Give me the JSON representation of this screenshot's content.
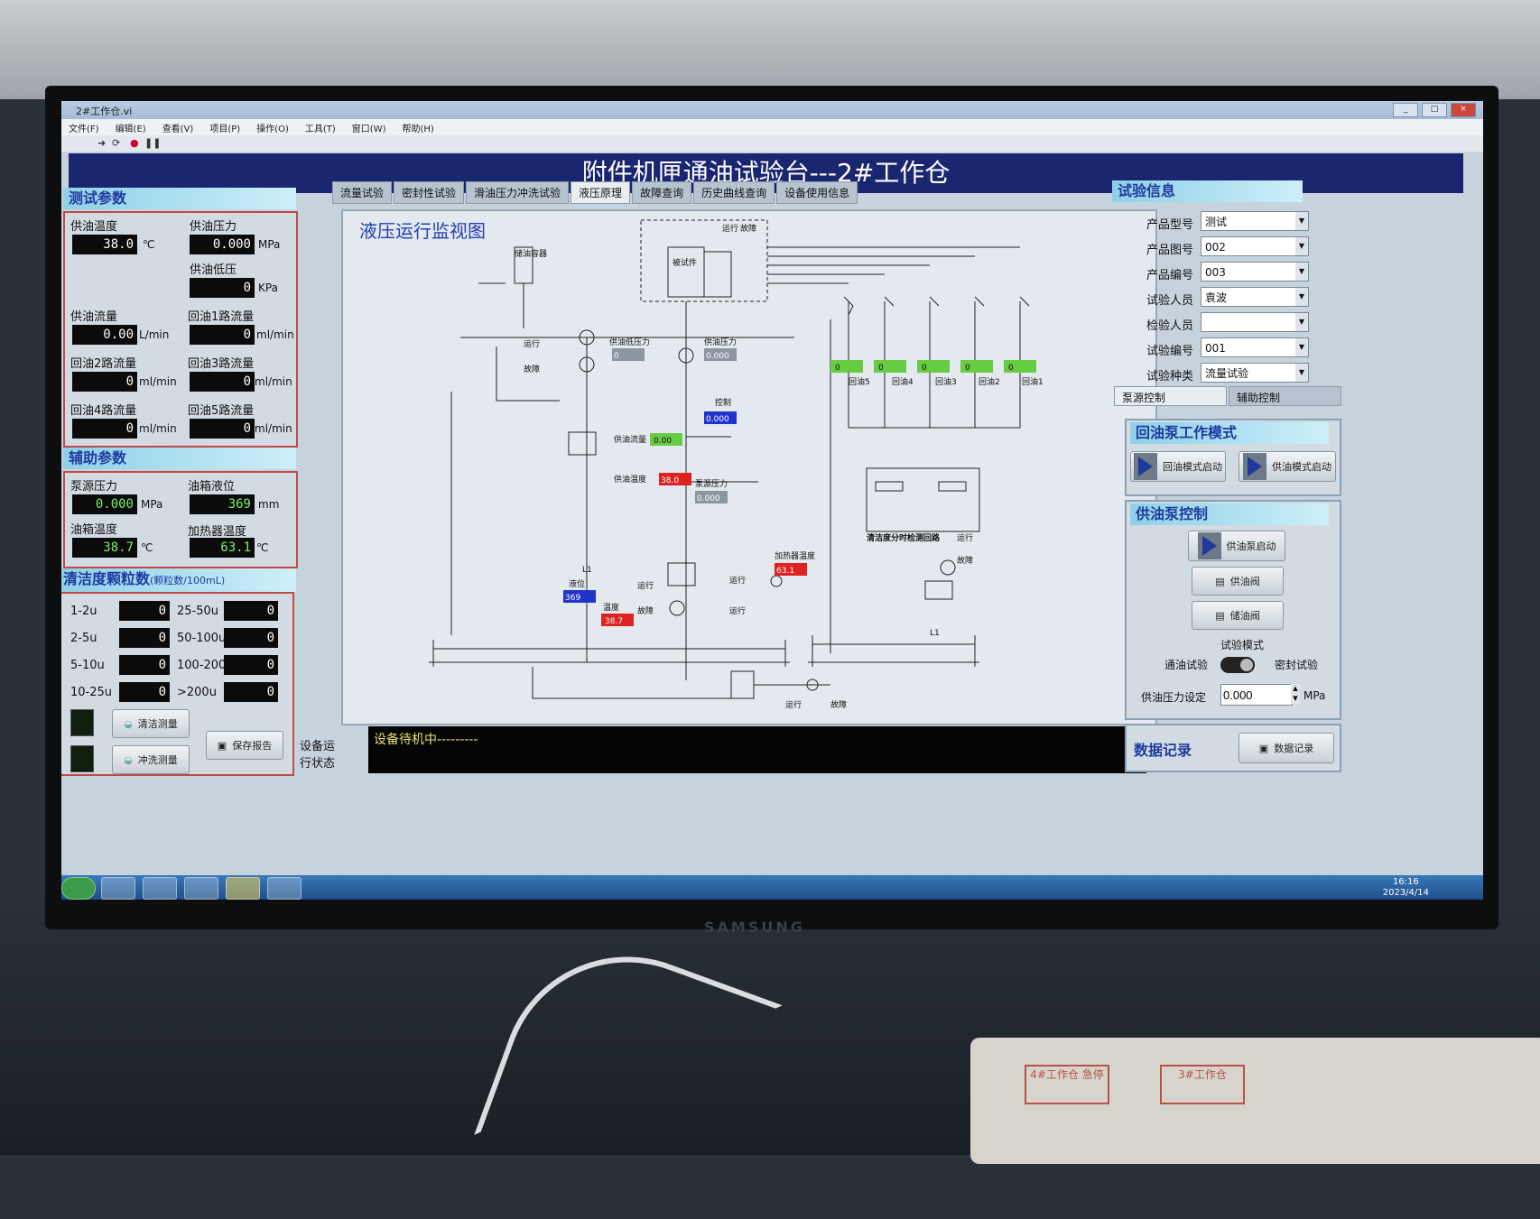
{
  "window": {
    "title": "2#工作仓.vi"
  },
  "menu": [
    "文件(F)",
    "编辑(E)",
    "查看(V)",
    "项目(P)",
    "操作(O)",
    "工具(T)",
    "窗口(W)",
    "帮助(H)"
  ],
  "header": {
    "title": "附件机匣通油试验台---2#工作仓"
  },
  "test_params": {
    "title": "测试参数",
    "supply_temp": {
      "label": "供油温度",
      "value": "38.0",
      "unit": "℃"
    },
    "supply_pressure": {
      "label": "供油压力",
      "value": "0.000",
      "unit": "MPa"
    },
    "supply_low_pressure": {
      "label": "供油低压",
      "value": "0",
      "unit": "KPa"
    },
    "supply_flow": {
      "label": "供油流量",
      "value": "0.00",
      "unit": "L/min"
    },
    "return1_flow": {
      "label": "回油1路流量",
      "value": "0",
      "unit": "ml/min"
    },
    "return2_flow": {
      "label": "回油2路流量",
      "value": "0",
      "unit": "ml/min"
    },
    "return3_flow": {
      "label": "回油3路流量",
      "value": "0",
      "unit": "ml/min"
    },
    "return4_flow": {
      "label": "回油4路流量",
      "value": "0",
      "unit": "ml/min"
    },
    "return5_flow": {
      "label": "回油5路流量",
      "value": "0",
      "unit": "ml/min"
    }
  },
  "aux_params": {
    "title": "辅助参数",
    "pump_pressure": {
      "label": "泵源压力",
      "value": "0.000",
      "unit": "MPa"
    },
    "tank_level": {
      "label": "油箱液位",
      "value": "369",
      "unit": "mm"
    },
    "tank_temp": {
      "label": "油箱温度",
      "value": "38.7",
      "unit": "℃"
    },
    "heater_temp": {
      "label": "加热器温度",
      "value": "63.1",
      "unit": "℃"
    }
  },
  "cleanliness": {
    "title": "清洁度颗粒数",
    "subtitle": "(颗粒数/100mL)",
    "rows": [
      {
        "l1": "1-2u",
        "v1": "0",
        "l2": "25-50u",
        "v2": "0"
      },
      {
        "l1": "2-5u",
        "v1": "0",
        "l2": "50-100u",
        "v2": "0"
      },
      {
        "l1": "5-10u",
        "v1": "0",
        "l2": "100-200u",
        "v2": "0"
      },
      {
        "l1": "10-25u",
        "v1": "0",
        "l2": ">200u",
        "v2": "0"
      }
    ],
    "btn_measure": "清洁测量",
    "btn_flush": "冲洗测量",
    "btn_save": "保存报告"
  },
  "tabs": [
    "流量试验",
    "密封性试验",
    "滑油压力冲洗试验",
    "液压原理",
    "故障查询",
    "历史曲线查询",
    "设备使用信息"
  ],
  "monitor": {
    "title": "液压运行监视图",
    "run": "运行",
    "fault": "故障",
    "fuel_container": "储油容器",
    "test_piece": "被试件",
    "supply_low_pressure": "供油低压力",
    "supply_pressure": "供油压力",
    "supply_low_val": "0",
    "supply_press_val": "0.000",
    "control": "控制",
    "control_val": "0.000",
    "supply_flow": "供油流量",
    "supply_flow_val": "0.00",
    "supply_temp": "供油温度",
    "supply_temp_val": "38.0",
    "pump_pressure": "泵源压力",
    "pump_pressure_val": "0.000",
    "heater_temp": "加热器温度",
    "heater_temp_val": "63.1",
    "level": "液位",
    "level_val": "369",
    "temp": "温度",
    "temp_val": "38.7",
    "l1": "L1",
    "cleanliness_loop": "清洁度分时检测回路",
    "returns": [
      "回油5",
      "回油4",
      "回油3",
      "回油2",
      "回油1"
    ],
    "return_vals": [
      "0",
      "0",
      "0",
      "0",
      "0"
    ]
  },
  "status": {
    "label_line1": "设备运",
    "label_line2": "行状态",
    "text": "设备待机中---------"
  },
  "test_info": {
    "title": "试验信息",
    "fields": [
      {
        "label": "产品型号",
        "value": "测试"
      },
      {
        "label": "产品图号",
        "value": "002"
      },
      {
        "label": "产品编号",
        "value": "003"
      },
      {
        "label": "试验人员",
        "value": "袁波"
      },
      {
        "label": "检验人员",
        "value": ""
      },
      {
        "label": "试验编号",
        "value": "001"
      },
      {
        "label": "试验种类",
        "value": "流量试验"
      }
    ]
  },
  "control_tabs": [
    "泵源控制",
    "辅助控制"
  ],
  "return_pump": {
    "title": "回油泵工作模式",
    "btn_return": "回油模式启动",
    "btn_supply": "供油模式启动"
  },
  "supply_pump": {
    "title": "供油泵控制",
    "btn_start": "供油泵启动",
    "btn_supply_valve": "供油阀",
    "btn_store_valve": "储油阀",
    "mode_label": "试验模式",
    "mode_left": "通油试验",
    "mode_right": "密封试验",
    "pressure_label": "供油压力设定",
    "pressure_value": "0.000",
    "pressure_unit": "MPa"
  },
  "data_record": {
    "title": "数据记录",
    "btn": "数据记录"
  },
  "taskbar": {
    "time": "16:16",
    "date": "2023/4/14"
  },
  "brand": "SAMSUNG",
  "device_labels": [
    "4#工作仓 急停",
    "3#工作仓"
  ]
}
